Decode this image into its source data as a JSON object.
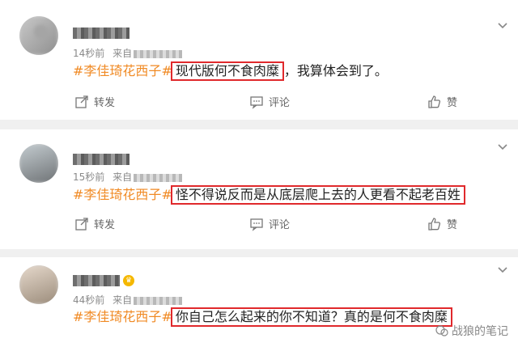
{
  "comments": [
    {
      "time": "14秒前",
      "source_prefix": "来自",
      "tag": "#李佳琦花西子#",
      "highlight": "现代版何不食肉糜",
      "rest": "，我算体会到了。"
    },
    {
      "time": "15秒前",
      "source_prefix": "来自",
      "tag": "#李佳琦花西子#",
      "highlight": "怪不得说反而是从底层爬上去的人更看不起老百姓",
      "rest": ""
    },
    {
      "time": "44秒前",
      "source_prefix": "来自",
      "tag": "#李佳琦花西子#",
      "highlight": "你自己怎么起来的你不知道？真的是何不食肉糜",
      "rest": ""
    }
  ],
  "actions": {
    "forward": "转发",
    "comment": "评论",
    "like": "赞"
  },
  "watermark": "战狼的笔记",
  "colors": {
    "tag": "#f08a24",
    "highlight_border": "#e0292c"
  }
}
